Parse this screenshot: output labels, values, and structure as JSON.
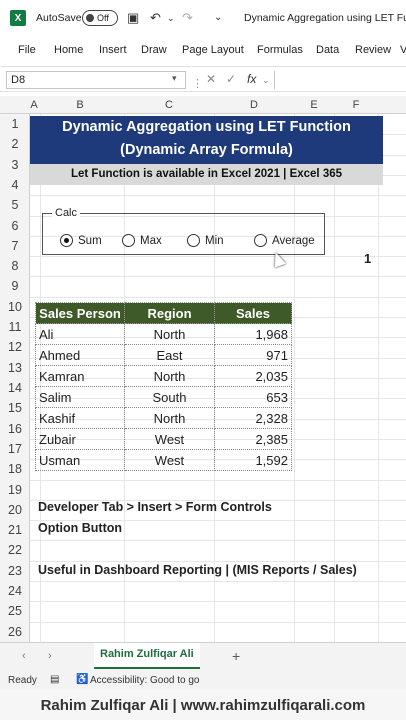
{
  "window": {
    "autosave_label": "AutoSave",
    "autosave_state": "Off",
    "title": "Dynamic Aggregation using LET Functi"
  },
  "menu": [
    "File",
    "Home",
    "Insert",
    "Draw",
    "Page Layout",
    "Formulas",
    "Data",
    "Review",
    "V"
  ],
  "formula_bar": {
    "name_box": "D8",
    "fx": "fx"
  },
  "columns": [
    "A",
    "B",
    "C",
    "D",
    "E",
    "F"
  ],
  "rows": [
    "1",
    "2",
    "3",
    "4",
    "5",
    "6",
    "7",
    "8",
    "9",
    "10",
    "11",
    "12",
    "13",
    "14",
    "15",
    "16",
    "17",
    "18",
    "19",
    "20",
    "21",
    "22",
    "23",
    "24",
    "25",
    "26"
  ],
  "banner": {
    "line1": "Dynamic Aggregation using LET Function",
    "line2": "(Dynamic Array Formula)",
    "sub": "Let Function is available in Excel 2021 | Excel 365"
  },
  "calc_group": {
    "label": "Calc",
    "options": [
      "Sum",
      "Max",
      "Min",
      "Average"
    ],
    "selected": "Sum",
    "linked_value": "1"
  },
  "table": {
    "headers": [
      "Sales Person",
      "Region",
      "Sales"
    ],
    "rows": [
      [
        "Ali",
        "North",
        "1,968"
      ],
      [
        "Ahmed",
        "East",
        "971"
      ],
      [
        "Kamran",
        "North",
        "2,035"
      ],
      [
        "Salim",
        "South",
        "653"
      ],
      [
        "Kashif",
        "North",
        "2,328"
      ],
      [
        "Zubair",
        "West",
        "2,385"
      ],
      [
        "Usman",
        "West",
        "1,592"
      ]
    ]
  },
  "notes": {
    "line1": "Developer Tab > Insert > Form Controls",
    "line2": "Option Button",
    "line3": "Useful in Dashboard Reporting | (MIS Reports / Sales)"
  },
  "sheet_tab": "Rahim Zulfiqar Ali",
  "status": {
    "ready": "Ready",
    "accessibility": "Accessibility: Good to go"
  },
  "footer": "Rahim Zulfiqar Ali | www.rahimzulfiqarali.com",
  "colors": {
    "banner": "#1f3a7a",
    "table_header": "#3e5a28",
    "excel_green": "#107c41"
  }
}
